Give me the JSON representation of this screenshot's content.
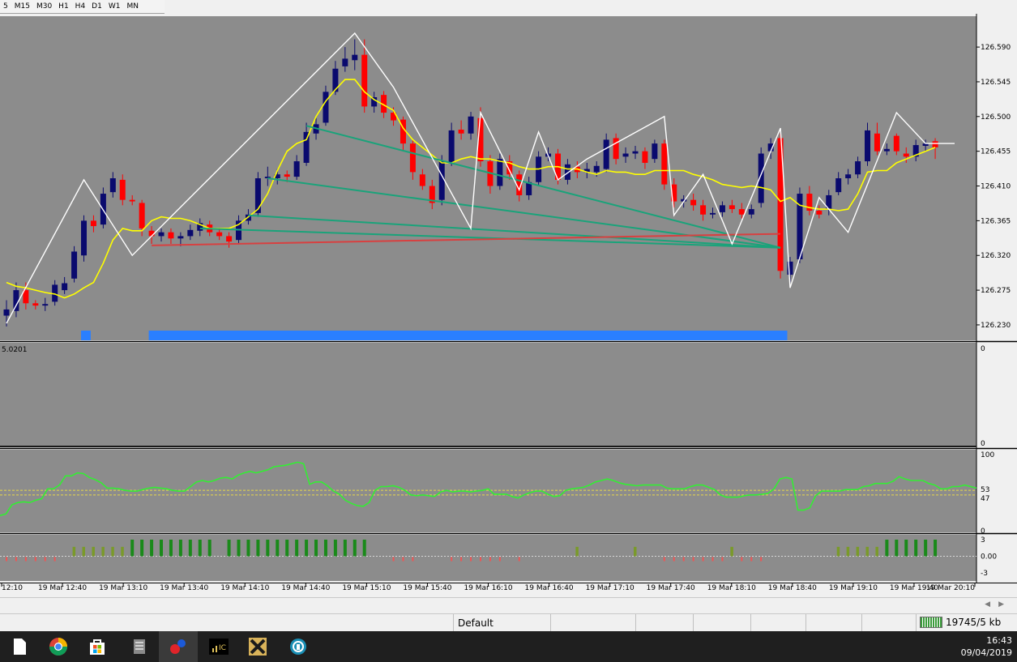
{
  "window": {
    "timeframes": [
      "5",
      "M15",
      "M30",
      "H1",
      "H4",
      "D1",
      "W1",
      "MN"
    ]
  },
  "chart_data": [
    {
      "type": "candlestick",
      "panel": "main",
      "y_ticks": [
        "126.590",
        "126.545",
        "126.500",
        "126.455",
        "126.410",
        "126.365",
        "126.320",
        "126.275",
        "126.230"
      ],
      "ylim": [
        126.21,
        126.63
      ],
      "x_ticks": [
        "12:10",
        "19 Mar 12:40",
        "19 Mar 13:10",
        "19 Mar 13:40",
        "19 Mar 14:10",
        "19 Mar 14:40",
        "19 Mar 15:10",
        "19 Mar 15:40",
        "19 Mar 16:10",
        "19 Mar 16:40",
        "19 Mar 17:10",
        "19 Mar 17:40",
        "19 Mar 18:10",
        "19 Mar 18:40",
        "19 Mar 19:10",
        "19 Mar 19:40",
        "19 Mar 20:10"
      ],
      "candles": [
        {
          "o": 126.242,
          "c": 126.25,
          "h": 126.262,
          "l": 126.228
        },
        {
          "o": 126.248,
          "c": 126.275,
          "h": 126.285,
          "l": 126.24
        },
        {
          "o": 126.275,
          "c": 126.258,
          "h": 126.285,
          "l": 126.25
        },
        {
          "o": 126.258,
          "c": 126.255,
          "h": 126.262,
          "l": 126.25
        },
        {
          "o": 126.255,
          "c": 126.257,
          "h": 126.265,
          "l": 126.248
        },
        {
          "o": 126.26,
          "c": 126.282,
          "h": 126.288,
          "l": 126.255
        },
        {
          "o": 126.275,
          "c": 126.284,
          "h": 126.292,
          "l": 126.27
        },
        {
          "o": 126.29,
          "c": 126.325,
          "h": 126.332,
          "l": 126.285
        },
        {
          "o": 126.32,
          "c": 126.365,
          "h": 126.372,
          "l": 126.312
        },
        {
          "o": 126.365,
          "c": 126.358,
          "h": 126.372,
          "l": 126.35
        },
        {
          "o": 126.36,
          "c": 126.4,
          "h": 126.408,
          "l": 126.355
        },
        {
          "o": 126.402,
          "c": 126.42,
          "h": 126.428,
          "l": 126.395
        },
        {
          "o": 126.418,
          "c": 126.392,
          "h": 126.425,
          "l": 126.385
        },
        {
          "o": 126.392,
          "c": 126.39,
          "h": 126.398,
          "l": 126.385
        },
        {
          "o": 126.388,
          "c": 126.355,
          "h": 126.392,
          "l": 126.345
        },
        {
          "o": 126.352,
          "c": 126.345,
          "h": 126.358,
          "l": 126.335
        },
        {
          "o": 126.345,
          "c": 126.35,
          "h": 126.355,
          "l": 126.338
        },
        {
          "o": 126.35,
          "c": 126.342,
          "h": 126.355,
          "l": 126.335
        },
        {
          "o": 126.342,
          "c": 126.345,
          "h": 126.35,
          "l": 126.332
        },
        {
          "o": 126.345,
          "c": 126.353,
          "h": 126.36,
          "l": 126.34
        },
        {
          "o": 126.352,
          "c": 126.362,
          "h": 126.368,
          "l": 126.345
        },
        {
          "o": 126.36,
          "c": 126.35,
          "h": 126.365,
          "l": 126.345
        },
        {
          "o": 126.35,
          "c": 126.345,
          "h": 126.356,
          "l": 126.34
        },
        {
          "o": 126.345,
          "c": 126.338,
          "h": 126.35,
          "l": 126.33
        },
        {
          "o": 126.34,
          "c": 126.365,
          "h": 126.372,
          "l": 126.335
        },
        {
          "o": 126.365,
          "c": 126.373,
          "h": 126.38,
          "l": 126.36
        },
        {
          "o": 126.375,
          "c": 126.42,
          "h": 126.428,
          "l": 126.37
        },
        {
          "o": 126.42,
          "c": 126.422,
          "h": 126.435,
          "l": 126.41
        },
        {
          "o": 126.42,
          "c": 126.425,
          "h": 126.432,
          "l": 126.412
        },
        {
          "o": 126.425,
          "c": 126.422,
          "h": 126.43,
          "l": 126.415
        },
        {
          "o": 126.422,
          "c": 126.442,
          "h": 126.45,
          "l": 126.418
        },
        {
          "o": 126.44,
          "c": 126.48,
          "h": 126.492,
          "l": 126.436
        },
        {
          "o": 126.478,
          "c": 126.49,
          "h": 126.498,
          "l": 126.47
        },
        {
          "o": 126.492,
          "c": 126.532,
          "h": 126.54,
          "l": 126.488
        },
        {
          "o": 126.532,
          "c": 126.562,
          "h": 126.572,
          "l": 126.528
        },
        {
          "o": 126.565,
          "c": 126.575,
          "h": 126.59,
          "l": 126.558
        },
        {
          "o": 126.573,
          "c": 126.58,
          "h": 126.6,
          "l": 126.56
        },
        {
          "o": 126.58,
          "c": 126.513,
          "h": 126.6,
          "l": 126.505
        },
        {
          "o": 126.513,
          "c": 126.525,
          "h": 126.532,
          "l": 126.505
        },
        {
          "o": 126.528,
          "c": 126.505,
          "h": 126.533,
          "l": 126.498
        },
        {
          "o": 126.505,
          "c": 126.495,
          "h": 126.512,
          "l": 126.488
        },
        {
          "o": 126.496,
          "c": 126.465,
          "h": 126.5,
          "l": 126.455
        },
        {
          "o": 126.465,
          "c": 126.428,
          "h": 126.47,
          "l": 126.418
        },
        {
          "o": 126.425,
          "c": 126.41,
          "h": 126.432,
          "l": 126.405
        },
        {
          "o": 126.41,
          "c": 126.388,
          "h": 126.418,
          "l": 126.38
        },
        {
          "o": 126.392,
          "c": 126.442,
          "h": 126.45,
          "l": 126.385
        },
        {
          "o": 126.44,
          "c": 126.482,
          "h": 126.492,
          "l": 126.436
        },
        {
          "o": 126.483,
          "c": 126.478,
          "h": 126.495,
          "l": 126.47
        },
        {
          "o": 126.478,
          "c": 126.5,
          "h": 126.506,
          "l": 126.47
        },
        {
          "o": 126.498,
          "c": 126.442,
          "h": 126.512,
          "l": 126.435
        },
        {
          "o": 126.442,
          "c": 126.41,
          "h": 126.45,
          "l": 126.4
        },
        {
          "o": 126.41,
          "c": 126.445,
          "h": 126.452,
          "l": 126.405
        },
        {
          "o": 126.442,
          "c": 126.425,
          "h": 126.45,
          "l": 126.418
        },
        {
          "o": 126.425,
          "c": 126.398,
          "h": 126.43,
          "l": 126.39
        },
        {
          "o": 126.398,
          "c": 126.415,
          "h": 126.422,
          "l": 126.392
        },
        {
          "o": 126.415,
          "c": 126.448,
          "h": 126.455,
          "l": 126.41
        },
        {
          "o": 126.448,
          "c": 126.452,
          "h": 126.46,
          "l": 126.442
        },
        {
          "o": 126.452,
          "c": 126.418,
          "h": 126.458,
          "l": 126.412
        },
        {
          "o": 126.418,
          "c": 126.438,
          "h": 126.445,
          "l": 126.412
        },
        {
          "o": 126.435,
          "c": 126.428,
          "h": 126.442,
          "l": 126.42
        },
        {
          "o": 126.428,
          "c": 126.432,
          "h": 126.44,
          "l": 126.42
        },
        {
          "o": 126.428,
          "c": 126.436,
          "h": 126.442,
          "l": 126.422
        },
        {
          "o": 126.432,
          "c": 126.47,
          "h": 126.478,
          "l": 126.428
        },
        {
          "o": 126.472,
          "c": 126.445,
          "h": 126.478,
          "l": 126.438
        },
        {
          "o": 126.448,
          "c": 126.452,
          "h": 126.46,
          "l": 126.44
        },
        {
          "o": 126.452,
          "c": 126.455,
          "h": 126.462,
          "l": 126.445
        },
        {
          "o": 126.455,
          "c": 126.44,
          "h": 126.46,
          "l": 126.432
        },
        {
          "o": 126.445,
          "c": 126.465,
          "h": 126.47,
          "l": 126.44
        },
        {
          "o": 126.465,
          "c": 126.412,
          "h": 126.47,
          "l": 126.405
        },
        {
          "o": 126.412,
          "c": 126.39,
          "h": 126.42,
          "l": 126.382
        },
        {
          "o": 126.39,
          "c": 126.393,
          "h": 126.398,
          "l": 126.382
        },
        {
          "o": 126.392,
          "c": 126.385,
          "h": 126.4,
          "l": 126.378
        },
        {
          "o": 126.385,
          "c": 126.373,
          "h": 126.392,
          "l": 126.365
        },
        {
          "o": 126.373,
          "c": 126.375,
          "h": 126.382,
          "l": 126.368
        },
        {
          "o": 126.376,
          "c": 126.385,
          "h": 126.39,
          "l": 126.37
        },
        {
          "o": 126.385,
          "c": 126.38,
          "h": 126.392,
          "l": 126.375
        },
        {
          "o": 126.38,
          "c": 126.373,
          "h": 126.388,
          "l": 126.368
        },
        {
          "o": 126.373,
          "c": 126.38,
          "h": 126.386,
          "l": 126.368
        },
        {
          "o": 126.388,
          "c": 126.452,
          "h": 126.46,
          "l": 126.382
        },
        {
          "o": 126.455,
          "c": 126.465,
          "h": 126.472,
          "l": 126.445
        },
        {
          "o": 126.472,
          "c": 126.3,
          "h": 126.478,
          "l": 126.29
        },
        {
          "o": 126.295,
          "c": 126.312,
          "h": 126.318,
          "l": 126.285
        },
        {
          "o": 126.315,
          "c": 126.4,
          "h": 126.408,
          "l": 126.31
        },
        {
          "o": 126.4,
          "c": 126.378,
          "h": 126.41,
          "l": 126.372
        },
        {
          "o": 126.378,
          "c": 126.373,
          "h": 126.385,
          "l": 126.368
        },
        {
          "o": 126.38,
          "c": 126.398,
          "h": 126.405,
          "l": 126.372
        },
        {
          "o": 126.402,
          "c": 126.42,
          "h": 126.428,
          "l": 126.398
        },
        {
          "o": 126.42,
          "c": 126.425,
          "h": 126.432,
          "l": 126.412
        },
        {
          "o": 126.425,
          "c": 126.442,
          "h": 126.448,
          "l": 126.42
        },
        {
          "o": 126.442,
          "c": 126.482,
          "h": 126.492,
          "l": 126.436
        },
        {
          "o": 126.478,
          "c": 126.455,
          "h": 126.492,
          "l": 126.45
        },
        {
          "o": 126.455,
          "c": 126.458,
          "h": 126.465,
          "l": 126.45
        },
        {
          "o": 126.475,
          "c": 126.455,
          "h": 126.478,
          "l": 126.45
        },
        {
          "o": 126.452,
          "c": 126.448,
          "h": 126.46,
          "l": 126.44
        },
        {
          "o": 126.448,
          "c": 126.463,
          "h": 126.47,
          "l": 126.442
        },
        {
          "o": 126.462,
          "c": 126.465,
          "h": 126.47,
          "l": 126.455
        },
        {
          "o": 126.468,
          "c": 126.46,
          "h": 126.472,
          "l": 126.445
        }
      ],
      "colors": {
        "bull": "#0a0a6e",
        "bear": "#ff0000",
        "background": "#8c8c8c",
        "zigzag": "#ffffff",
        "ma": "#ffff00",
        "trend_green": "#1aa37a",
        "trend_red": "#d84040",
        "signal_bar": "#2a7fff"
      },
      "yellow_ma": [
        126.285,
        126.28,
        126.278,
        126.275,
        126.272,
        126.27,
        126.265,
        126.27,
        126.278,
        126.285,
        126.31,
        126.34,
        126.355,
        126.352,
        126.352,
        126.365,
        126.37,
        126.368,
        126.368,
        126.365,
        126.36,
        126.355,
        126.355,
        126.355,
        126.36,
        126.37,
        126.38,
        126.4,
        126.43,
        126.455,
        126.465,
        126.47,
        126.5,
        126.52,
        126.535,
        126.548,
        126.548,
        126.532,
        126.522,
        126.515,
        126.508,
        126.485,
        126.47,
        126.46,
        126.45,
        126.44,
        126.44,
        126.445,
        126.448,
        126.445,
        126.445,
        126.442,
        126.44,
        126.435,
        126.432,
        126.432,
        126.435,
        126.435,
        126.432,
        126.432,
        126.428,
        126.425,
        126.43,
        126.428,
        126.428,
        126.425,
        126.425,
        126.43,
        126.43,
        126.43,
        126.43,
        126.425,
        126.422,
        126.418,
        126.412,
        126.41,
        126.408,
        126.41,
        126.408,
        126.405,
        126.39,
        126.395,
        126.385,
        126.382,
        126.38,
        126.38,
        126.378,
        126.38,
        126.4,
        126.428,
        126.43,
        126.43,
        126.44,
        126.445,
        126.45,
        126.455,
        126.46
      ],
      "zigzag": [
        [
          0,
          126.232
        ],
        [
          8,
          126.418
        ],
        [
          13,
          126.32
        ],
        [
          36,
          126.608
        ],
        [
          40,
          126.538
        ],
        [
          48,
          126.355
        ],
        [
          49,
          126.505
        ],
        [
          53,
          126.405
        ],
        [
          55,
          126.48
        ],
        [
          57,
          126.418
        ],
        [
          60,
          126.445
        ],
        [
          68,
          126.5
        ],
        [
          69,
          126.372
        ],
        [
          72,
          126.425
        ],
        [
          75,
          126.335
        ],
        [
          80,
          126.485
        ],
        [
          81,
          126.278
        ],
        [
          84,
          126.395
        ],
        [
          87,
          126.35
        ],
        [
          92,
          126.505
        ],
        [
          95,
          126.465
        ],
        [
          98,
          126.465
        ]
      ],
      "trendlines": [
        {
          "color": "green",
          "from": [
            31,
            126.488
          ],
          "to": [
            80,
            126.33
          ]
        },
        {
          "color": "green",
          "from": [
            27,
            126.42
          ],
          "to": [
            80,
            126.33
          ]
        },
        {
          "color": "green",
          "from": [
            25,
            126.372
          ],
          "to": [
            80,
            126.33
          ]
        },
        {
          "color": "green",
          "from": [
            20,
            126.355
          ],
          "to": [
            80,
            126.33
          ]
        },
        {
          "color": "red",
          "from": [
            15,
            126.333
          ],
          "to": [
            80,
            126.348
          ]
        }
      ],
      "signal_bars": [
        [
          8,
          9
        ],
        [
          15,
          81
        ]
      ]
    },
    {
      "type": "line",
      "panel": "indicator-1",
      "value_label": "5.0201",
      "y_ticks": [
        "0",
        "0"
      ],
      "ylim": [
        0,
        1
      ]
    },
    {
      "type": "line",
      "panel": "oscillator",
      "y_ticks": [
        "100",
        "53",
        "47",
        "0"
      ],
      "ylim": [
        0,
        100
      ],
      "levels": [
        53,
        47
      ],
      "series": [
        {
          "values": [
            20,
            22,
            34,
            37,
            38,
            37,
            40,
            42,
            55,
            55,
            60,
            72,
            72,
            76,
            75,
            70,
            67,
            63,
            56,
            56,
            55,
            53,
            52,
            52,
            54,
            56,
            57,
            56,
            55,
            53,
            52,
            52,
            58,
            64,
            66,
            64,
            66,
            69,
            70,
            68,
            73,
            76,
            78,
            76,
            78,
            80,
            84,
            85,
            86,
            88,
            90,
            88,
            61,
            64,
            64,
            59,
            52,
            48,
            40,
            36,
            33,
            32,
            37,
            53,
            58,
            58,
            59,
            57,
            53,
            47,
            46,
            47,
            46,
            45,
            51,
            53,
            51,
            52,
            52,
            51,
            52,
            53,
            55,
            48,
            48,
            48,
            45,
            43,
            47,
            50,
            52,
            52,
            48,
            45,
            46,
            53,
            55,
            56,
            57,
            60,
            64,
            66,
            68,
            66,
            63,
            61,
            60,
            59,
            60,
            60,
            60,
            60,
            56,
            55,
            55,
            55,
            58,
            60,
            60,
            57,
            54,
            47,
            44,
            44,
            44,
            46,
            47,
            47,
            48,
            49,
            55,
            68,
            70,
            68,
            27,
            27,
            30,
            46,
            52,
            52,
            52,
            52,
            54,
            54,
            54,
            58,
            59,
            62,
            62,
            62,
            65,
            71,
            68,
            66,
            66,
            66,
            62,
            60,
            55,
            55,
            58,
            58,
            60,
            58,
            56
          ]
        }
      ]
    },
    {
      "type": "bar",
      "panel": "histogram",
      "y_ticks": [
        "3",
        "0.00",
        "-3"
      ],
      "ylim": [
        -3,
        3
      ]
    }
  ],
  "statusbar": {
    "profile": "Default",
    "traffic": "19745/5 kb"
  },
  "taskbar": {
    "time": "16:43",
    "date": "09/04/2019",
    "icons": [
      "file-icon",
      "chrome-icon",
      "store-icon",
      "app-icon",
      "mt-icon",
      "chart-app-icon",
      "x-app-icon",
      "sync-app-icon"
    ]
  }
}
